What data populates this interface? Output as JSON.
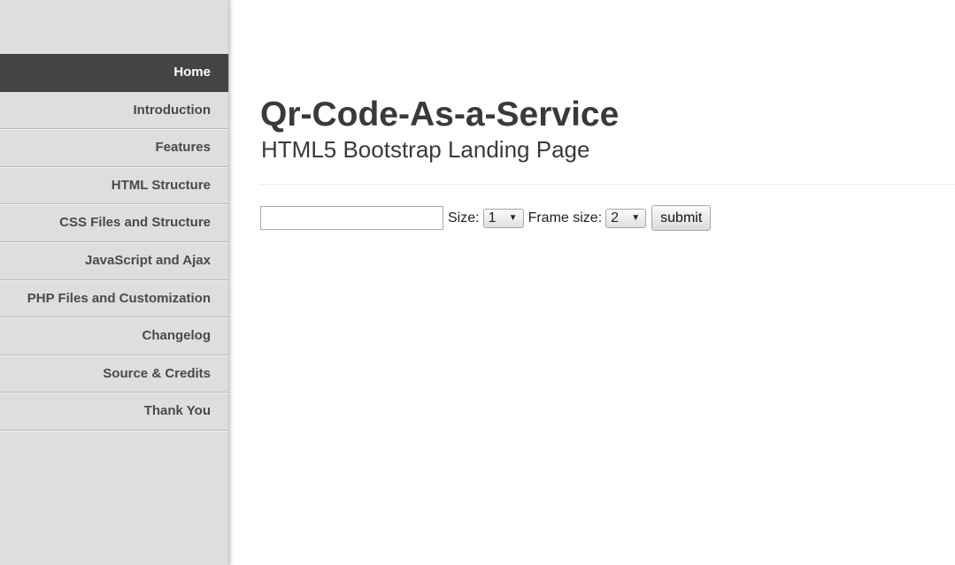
{
  "sidebar": {
    "items": [
      {
        "label": "Home",
        "active": true
      },
      {
        "label": "Introduction"
      },
      {
        "label": "Features"
      },
      {
        "label": "HTML Structure"
      },
      {
        "label": "CSS Files and Structure"
      },
      {
        "label": "JavaScript and Ajax"
      },
      {
        "label": "PHP Files and Customization"
      },
      {
        "label": "Changelog"
      },
      {
        "label": "Source & Credits"
      },
      {
        "label": "Thank You"
      }
    ]
  },
  "header": {
    "title": "Qr-Code-As-a-Service",
    "subtitle": "HTML5 Bootstrap Landing Page"
  },
  "form": {
    "text_value": "",
    "size_label": "Size:",
    "size_selected": "1",
    "frame_label": "Frame size:",
    "frame_selected": "2",
    "submit_label": "submit",
    "dropdown_icon": "triangle-down-icon"
  },
  "colors": {
    "sidebar_bg": "#dedede",
    "active_bg": "#444444",
    "text": "#3a3a3a"
  }
}
